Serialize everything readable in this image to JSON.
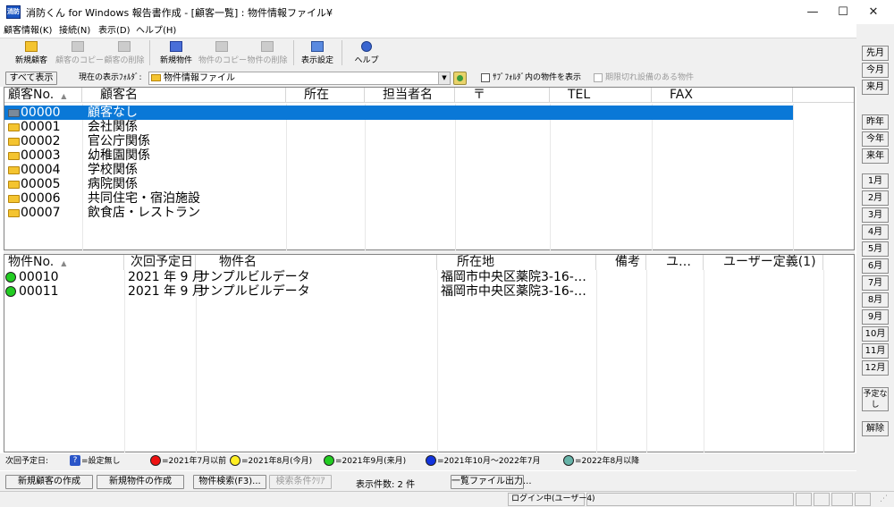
{
  "window": {
    "app_icon_label": "消防",
    "title": "消防くん for Windows 報告書作成 - [顧客一覧] : 物件情報ファイル¥",
    "minimize": "—",
    "maximize": "☐",
    "close": "✕"
  },
  "menu": [
    "顧客情報(K)",
    "接続(N)",
    "表示(D)",
    "ヘルプ(H)"
  ],
  "toolbar": [
    {
      "label": "新規顧客",
      "enabled": true
    },
    {
      "label": "顧客のコピー",
      "enabled": false
    },
    {
      "label": "顧客の削除",
      "enabled": false
    },
    {
      "label": "新規物件",
      "enabled": true
    },
    {
      "label": "物件のコピー",
      "enabled": false
    },
    {
      "label": "物件の削除",
      "enabled": false
    },
    {
      "label": "表示設定",
      "enabled": true
    },
    {
      "label": "ヘルプ",
      "enabled": true
    }
  ],
  "filter": {
    "show_all": "すべて表示",
    "folder_label": "現在の表示ﾌｫﾙﾀﾞ:",
    "folder_value": "物件情報ファイル",
    "subfolder_label": "ｻﾌﾞﾌｫﾙﾀﾞ内の物件を表示",
    "expired_label": "期限切れ設備のある物件"
  },
  "customers": {
    "columns": [
      "顧客No.",
      "顧客名",
      "所在",
      "担当者名",
      "〒",
      "TEL",
      "FAX"
    ],
    "rows": [
      {
        "no": "00000",
        "name": "顧客なし",
        "selected": true
      },
      {
        "no": "00001",
        "name": "会社関係"
      },
      {
        "no": "00002",
        "name": "官公庁関係"
      },
      {
        "no": "00003",
        "name": "幼稚園関係"
      },
      {
        "no": "00004",
        "name": "学校関係"
      },
      {
        "no": "00005",
        "name": "病院関係"
      },
      {
        "no": "00006",
        "name": "共同住宅・宿泊施設"
      },
      {
        "no": "00007",
        "name": "飲食店・レストラン"
      }
    ]
  },
  "properties": {
    "columns": [
      "物件No.",
      "次回予定日",
      "物件名",
      "所在地",
      "備考",
      "ユ…",
      "ユーザー定義(1)"
    ],
    "rows": [
      {
        "no": "00010",
        "date": "2021 年 9 月",
        "name": "サンプルビルデータ",
        "address": "福岡市中央区薬院3-16-…",
        "status_color": "#22cc22"
      },
      {
        "no": "00011",
        "date": "2021 年 9 月",
        "name": "サンプルビルデータ",
        "address": "福岡市中央区薬院3-16-…",
        "status_color": "#22cc22"
      }
    ]
  },
  "right_panel": {
    "group1": [
      "先月",
      "今月",
      "来月"
    ],
    "group2": [
      "昨年",
      "今年",
      "来年"
    ],
    "months": [
      "1月",
      "2月",
      "3月",
      "4月",
      "5月",
      "6月",
      "7月",
      "8月",
      "9月",
      "10月",
      "11月",
      "12月"
    ],
    "no_plan": "予定なし",
    "clear": "解除"
  },
  "legend": {
    "label": "次回予定日:",
    "unset": "=設定無し",
    "items": [
      {
        "text": "=2021年7月以前",
        "color": "#ee1111"
      },
      {
        "text": "=2021年8月(今月)",
        "color": "#ffee22"
      },
      {
        "text": "=2021年9月(来月)",
        "color": "#22cc22"
      },
      {
        "text": "=2021年10月～2022年7月",
        "color": "#1133dd"
      },
      {
        "text": "=2022年8月以降",
        "color": "#66b3a8"
      }
    ]
  },
  "bottom": {
    "new_customer": "新規顧客の作成",
    "new_property": "新規物件の作成",
    "search": "物件検索(F3)...",
    "clear_search": "検索条件ｸﾘｱ",
    "count": "表示件数: 2 件",
    "export": "一覧ファイル出力..."
  },
  "status": {
    "login": "ログイン中(ユーザー4)"
  }
}
